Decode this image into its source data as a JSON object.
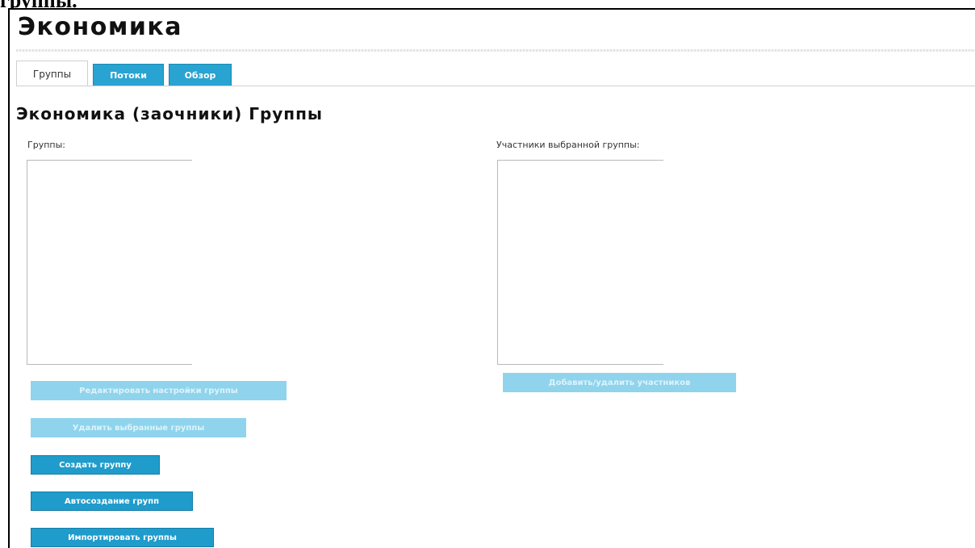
{
  "document": {
    "caption": "группы."
  },
  "page": {
    "title": "Экономика"
  },
  "tabs": [
    {
      "label": "Группы",
      "active": true
    },
    {
      "label": "Потоки",
      "active": false
    },
    {
      "label": "Обзор",
      "active": false
    }
  ],
  "section": {
    "title": "Экономика (заочники) Группы"
  },
  "groups_panel": {
    "label": "Группы:",
    "items": []
  },
  "members_panel": {
    "label": "Участники выбранной группы:",
    "items": [],
    "add_remove_label": "Добавить/удалить участников"
  },
  "actions": {
    "edit_settings": "Редактировать настройки группы",
    "delete_selected": "Удалить выбранные группы",
    "create_group": "Создать группу",
    "auto_create": "Автосоздание групп",
    "import_groups": "Импортировать группы"
  },
  "colors": {
    "button_enabled": "#1f9ccb",
    "button_disabled": "#8fd4ec",
    "tab_inactive": "#29a3d1"
  }
}
